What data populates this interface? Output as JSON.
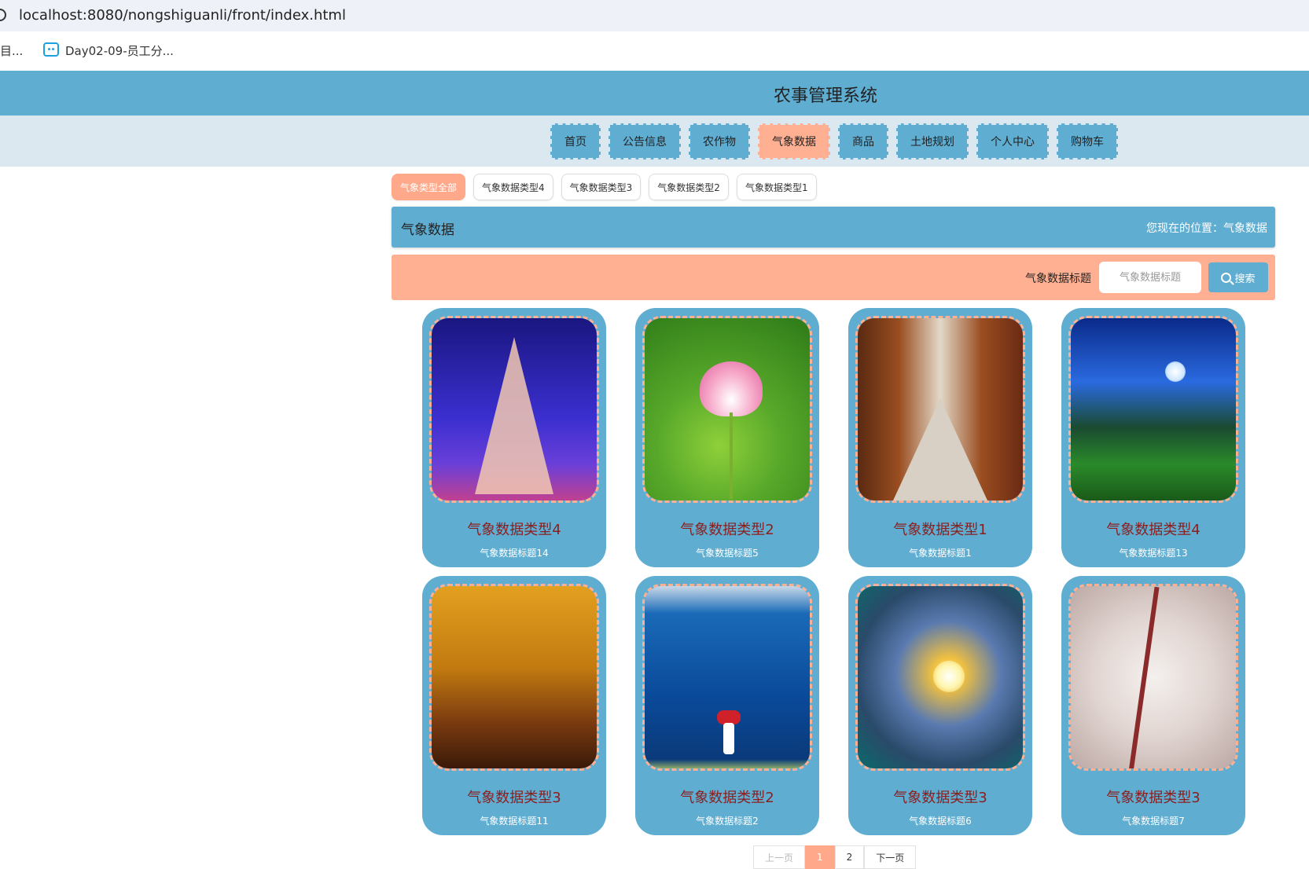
{
  "browser": {
    "url": "localhost:8080/nongshiguanli/front/index.html",
    "bookmark_cut": "目...",
    "bookmark_label": "Day02-09-员工分..."
  },
  "site": {
    "title": "农事管理系统"
  },
  "nav": {
    "items": [
      {
        "label": "首页",
        "active": false
      },
      {
        "label": "公告信息",
        "active": false
      },
      {
        "label": "农作物",
        "active": false
      },
      {
        "label": "气象数据",
        "active": true
      },
      {
        "label": "商品",
        "active": false
      },
      {
        "label": "土地规划",
        "active": false
      },
      {
        "label": "个人中心",
        "active": false
      },
      {
        "label": "购物车",
        "active": false
      }
    ]
  },
  "categories": [
    {
      "label": "气象类型全部",
      "active": true
    },
    {
      "label": "气象数据类型4",
      "active": false
    },
    {
      "label": "气象数据类型3",
      "active": false
    },
    {
      "label": "气象数据类型2",
      "active": false
    },
    {
      "label": "气象数据类型1",
      "active": false
    }
  ],
  "breadcrumb": {
    "title": "气象数据",
    "prefix": "您现在的位置：",
    "location": "气象数据"
  },
  "search": {
    "label": "气象数据标题",
    "placeholder": "气象数据标题",
    "button": "搜索"
  },
  "cards": [
    {
      "type": "气象数据类型4",
      "title": "气象数据标题14",
      "image": "eiffel"
    },
    {
      "type": "气象数据类型2",
      "title": "气象数据标题5",
      "image": "lotus"
    },
    {
      "type": "气象数据类型1",
      "title": "气象数据标题1",
      "image": "corridor"
    },
    {
      "type": "气象数据类型4",
      "title": "气象数据标题13",
      "image": "field"
    },
    {
      "type": "气象数据类型3",
      "title": "气象数据标题11",
      "image": "autumn"
    },
    {
      "type": "气象数据类型2",
      "title": "气象数据标题2",
      "image": "lake"
    },
    {
      "type": "气象数据类型3",
      "title": "气象数据标题6",
      "image": "sunset"
    },
    {
      "type": "气象数据类型3",
      "title": "气象数据标题7",
      "image": "blossom"
    }
  ],
  "pagination": {
    "prev": "上一页",
    "pages": [
      "1",
      "2"
    ],
    "current": "1",
    "next": "下一页"
  },
  "colors": {
    "primary": "#5fadd1",
    "accent": "#ffb092",
    "card_type_text": "#8b1e1e"
  }
}
